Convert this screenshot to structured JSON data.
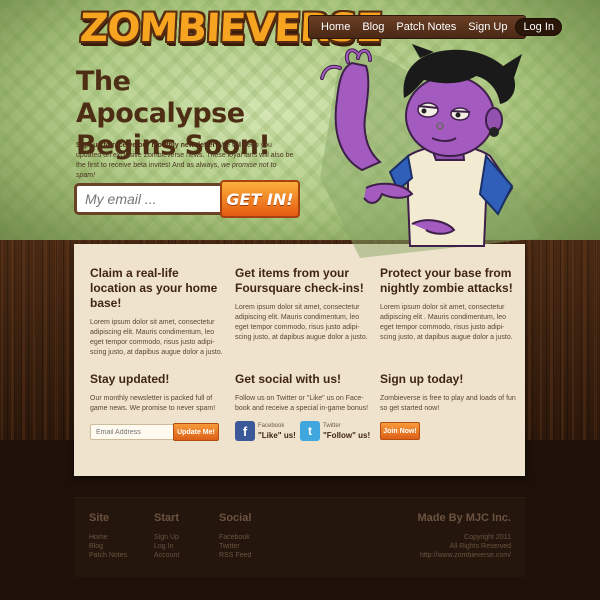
{
  "brand": {
    "logo_text": "ZOMBIEVERSE"
  },
  "nav": {
    "items": [
      "Home",
      "Blog",
      "Patch Notes",
      "Sign Up"
    ],
    "login": "Log In"
  },
  "hero": {
    "headline_line1": "The Apocalypse",
    "headline_line2": "Begins Soon!",
    "intro_bold": "Sign up to receive our monthly newsletter!",
    "intro_text": " We will keep you updated on exclusive Zombieverse news. These loyal fans will also be the first to receive beta invites! And as always, ",
    "intro_italic": "we promise not to spam!",
    "email_placeholder": "My email ...",
    "cta_label": "GET IN!"
  },
  "features": [
    {
      "title": "Claim a real-life location as your home base!",
      "body": "Lorem ipsum dolor sit amet, consectetur adipiscing elit. Mauris condimentum, leo eget tempor commodo, risus justo adipi-scing justo, at dapibus augue dolor a justo."
    },
    {
      "title": "Get items from your Foursquare check-ins!",
      "body": "Lorem ipsum dolor sit amet, consectetur adipiscing elit. Mauris condimentum, leo eget tempor commodo, risus justo adipi-scing justo, at dapibus augue dolor a justo."
    },
    {
      "title": "Protect your base from nightly zombie attacks!",
      "body": "Lorem ipsum dolor sit amet, consectetur adipiscing elit . Mauris condimentum, leo eget tempor commodo, risus justo adipi-scing justo, at dapibus augue dolor a justo."
    }
  ],
  "stay_updated": {
    "title": "Stay updated!",
    "body": "Our monthly newsletter is packed full of game news. We promise to never spam!",
    "email_placeholder": "Email Address",
    "button": "Update Me!"
  },
  "get_social": {
    "title": "Get social with us!",
    "body": "Follow us on Twitter or \"Like\" us on Face-book and receive a special in-game bonus!",
    "facebook_small": "Facebook",
    "facebook_label": "\"Like\" us!",
    "twitter_small": "Twitter",
    "twitter_label": "\"Follow\" us!"
  },
  "sign_up": {
    "title": "Sign up today!",
    "body": "Zombieverse is free to play and loads of fun so get started now!",
    "button": "Join Now!"
  },
  "footer": {
    "site": {
      "title": "Site",
      "links": [
        "Home",
        "Blog",
        "Patch Notes"
      ]
    },
    "start": {
      "title": "Start",
      "links": [
        "Sign Up",
        "Log In",
        "Account"
      ]
    },
    "social": {
      "title": "Social",
      "links": [
        "Facebook",
        "Twitter",
        "RSS Feed"
      ]
    },
    "credit": {
      "title": "Made By MJC Inc.",
      "copyright": "Copyright 2011",
      "rights": "All Rights Reserved",
      "url": "http://www.zombieverse.com/"
    }
  },
  "colors": {
    "accent_orange": "#f7a520",
    "brown_dark": "#4d2d14",
    "panel_bg": "#efe3cd",
    "zombie_skin": "#a35bbf",
    "shirt_blue": "#2f5fb8"
  },
  "icons": {
    "facebook": "facebook-icon",
    "twitter": "twitter-icon"
  }
}
